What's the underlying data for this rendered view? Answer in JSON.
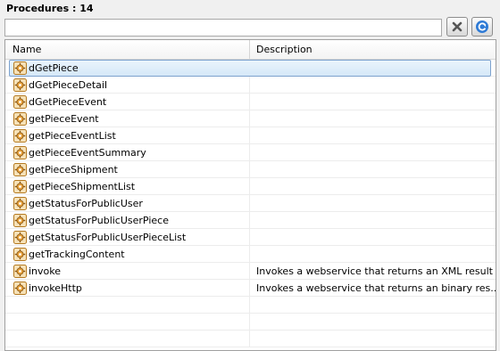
{
  "header": {
    "title": "Procedures : 14"
  },
  "search": {
    "value": "",
    "placeholder": ""
  },
  "toolbar": {
    "clear_icon": "clear-x-icon",
    "refresh_icon": "refresh-icon"
  },
  "table": {
    "columns": [
      "Name",
      "Description"
    ],
    "rows": [
      {
        "name": "dGetPiece",
        "description": ""
      },
      {
        "name": "dGetPieceDetail",
        "description": ""
      },
      {
        "name": "dGetPieceEvent",
        "description": ""
      },
      {
        "name": "getPieceEvent",
        "description": ""
      },
      {
        "name": "getPieceEventList",
        "description": ""
      },
      {
        "name": "getPieceEventSummary",
        "description": ""
      },
      {
        "name": "getPieceShipment",
        "description": ""
      },
      {
        "name": "getPieceShipmentList",
        "description": ""
      },
      {
        "name": "getStatusForPublicUser",
        "description": ""
      },
      {
        "name": "getStatusForPublicUserPiece",
        "description": ""
      },
      {
        "name": "getStatusForPublicUserPieceList",
        "description": ""
      },
      {
        "name": "getTrackingContent",
        "description": ""
      },
      {
        "name": "invoke",
        "description": "Invokes a webservice that returns an XML result"
      },
      {
        "name": "invokeHttp",
        "description": "Invokes a webservice that returns an binary res..."
      }
    ],
    "selected_index": 0,
    "row_icon": "procedure-gear-icon",
    "empty_rows": 3
  },
  "colors": {
    "selection_border": "#7da2ce",
    "selection_fill": "#d5e8f8",
    "icon_orange": "#e8a33c"
  }
}
